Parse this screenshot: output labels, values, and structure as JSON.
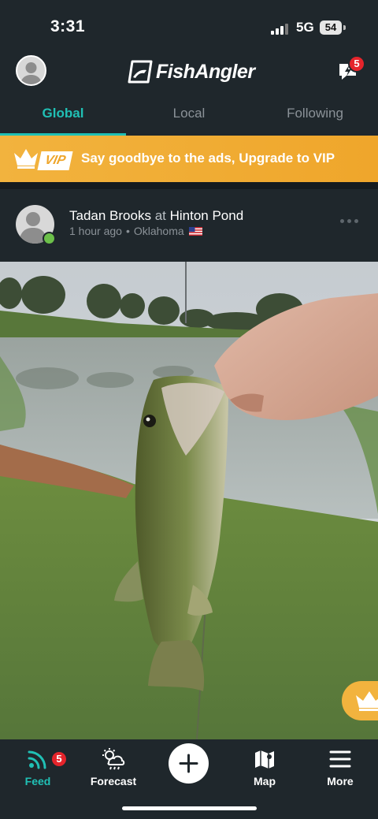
{
  "status_bar": {
    "time": "3:31",
    "network": "5G",
    "battery": "54"
  },
  "header": {
    "app_name": "FishAngler",
    "notification_count": "5"
  },
  "tabs": [
    {
      "label": "Global",
      "active": true
    },
    {
      "label": "Local",
      "active": false
    },
    {
      "label": "Following",
      "active": false
    }
  ],
  "vip_banner": {
    "tag": "VIP",
    "text": "Say goodbye to the ads, Upgrade to VIP"
  },
  "post": {
    "author": "Tadan Brooks",
    "at_word": "at",
    "location": "Hinton Pond",
    "time_ago": "1 hour ago",
    "separator": "•",
    "region": "Oklahoma"
  },
  "bottom_nav": {
    "feed_label": "Feed",
    "feed_badge": "5",
    "forecast_label": "Forecast",
    "map_label": "Map",
    "more_label": "More"
  },
  "colors": {
    "accent": "#20c0b5",
    "vip": "#f2b33e",
    "badge": "#e5242b",
    "background": "#1f272c"
  }
}
